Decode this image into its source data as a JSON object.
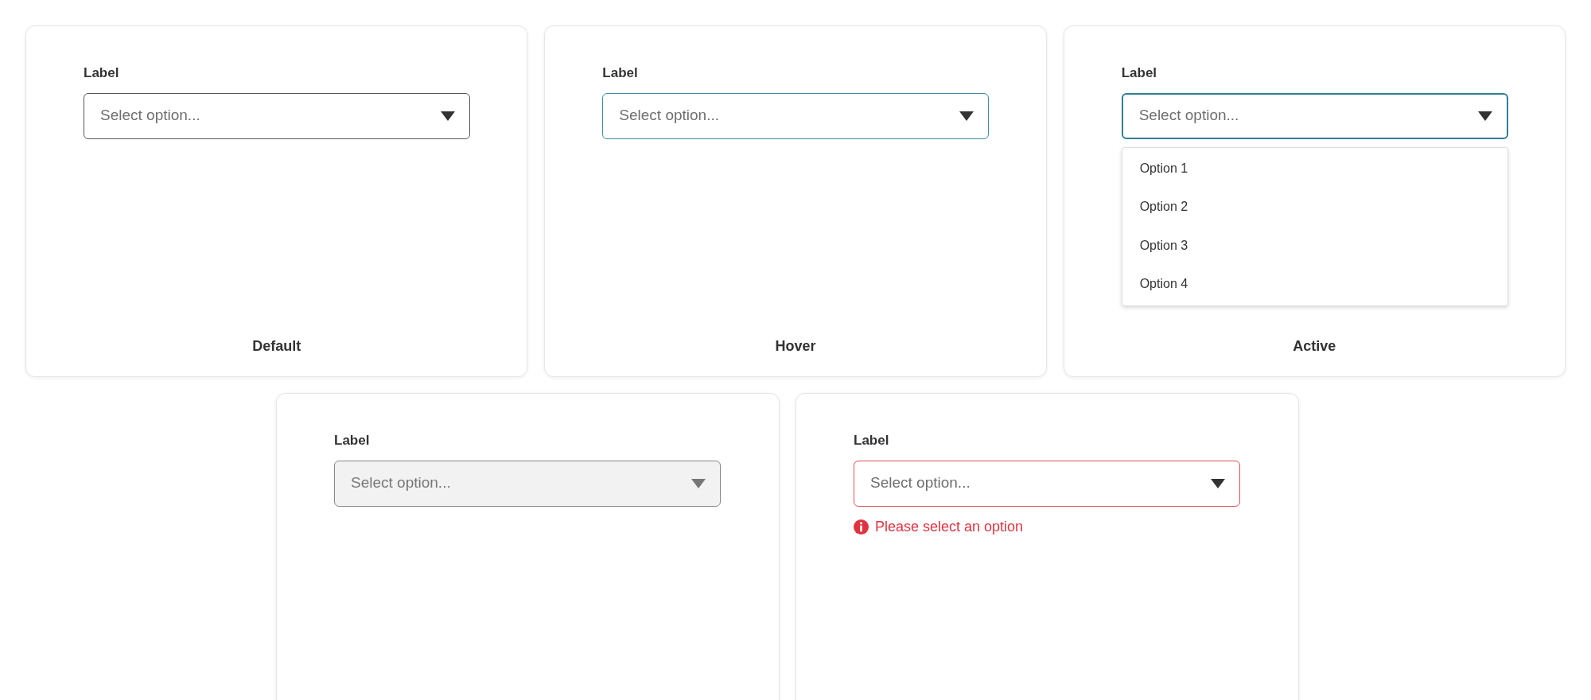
{
  "rows": [
    {
      "cards": [
        {
          "kind": "default",
          "label": "Label",
          "placeholder": "Select option...",
          "caption": "Default"
        },
        {
          "kind": "hover",
          "label": "Label",
          "placeholder": "Select option...",
          "caption": "Hover"
        },
        {
          "kind": "active",
          "label": "Label",
          "placeholder": "Select option...",
          "caption": "Active",
          "expanded": true,
          "options": [
            "Option 1",
            "Option 2",
            "Option 3",
            "Option 4"
          ]
        }
      ]
    },
    {
      "cards": [
        {
          "kind": "disabled",
          "label": "Label",
          "placeholder": "Select option..."
        },
        {
          "kind": "error",
          "label": "Label",
          "placeholder": "Select option...",
          "error": "Please select an option"
        }
      ]
    }
  ]
}
